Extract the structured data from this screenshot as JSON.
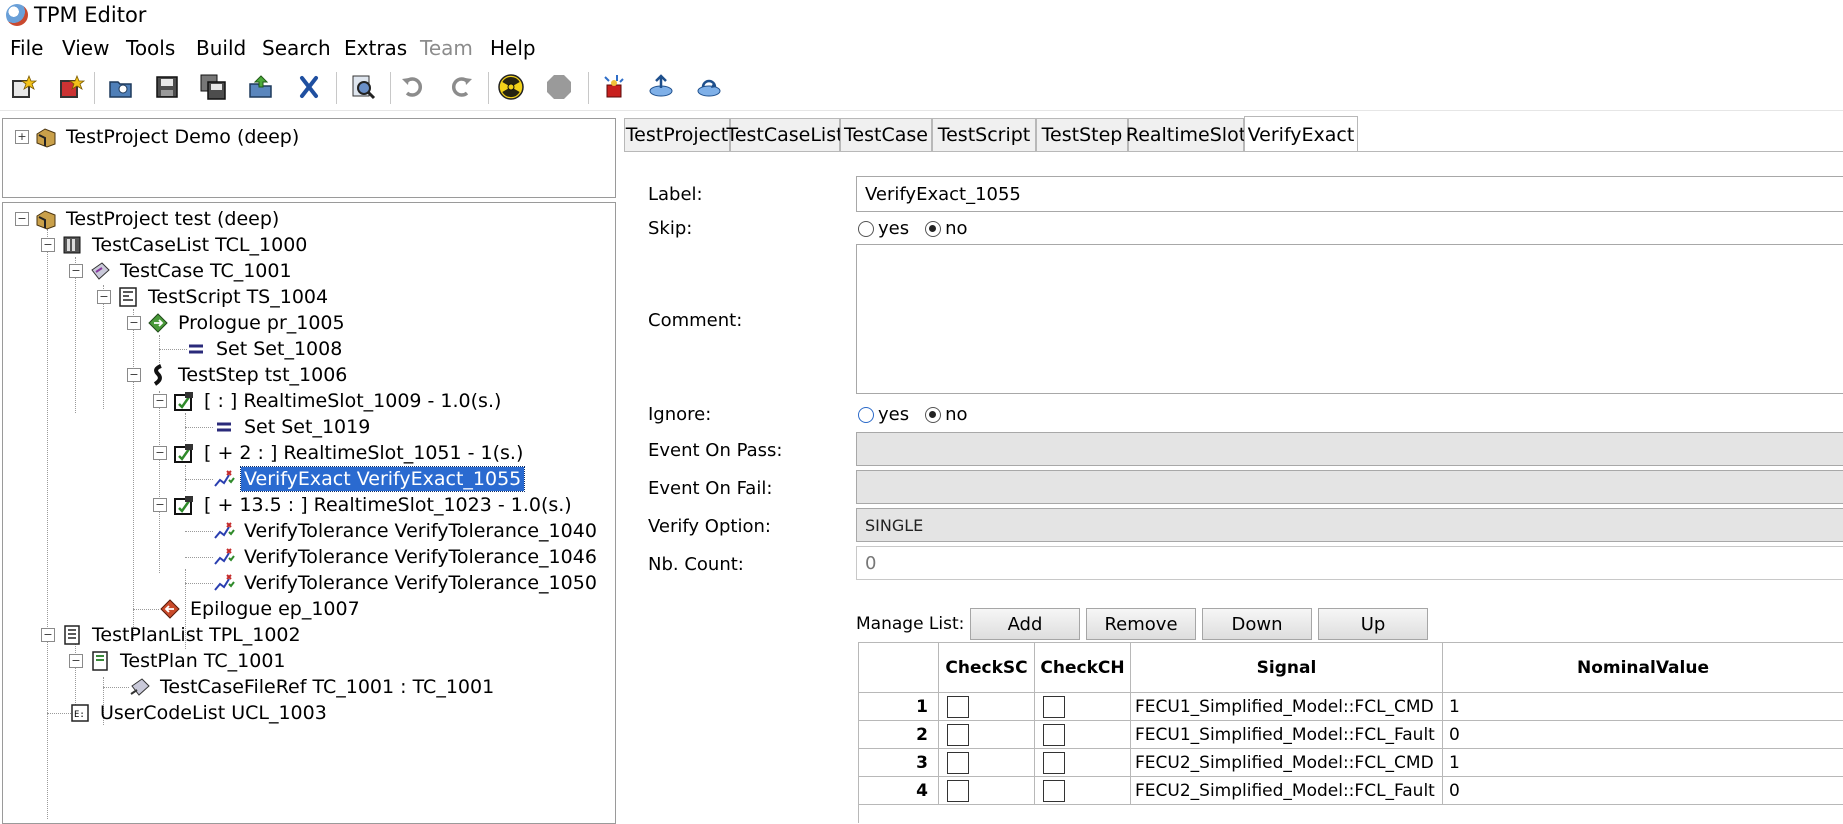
{
  "window": {
    "title": "TPM Editor",
    "app_icon": "tpm-globe-icon"
  },
  "menu": [
    "File",
    "View",
    "Tools",
    "Build",
    "Search",
    "Extras",
    "Team",
    "Help"
  ],
  "menu_disabled": [
    "Team"
  ],
  "toolbar": {
    "icons": [
      "new-project-icon",
      "new-file-icon",
      "open-icon",
      "save-icon",
      "save-all-icon",
      "export-icon",
      "delete-icon",
      "find-icon",
      "undo-icon",
      "redo-icon",
      "radiation-run-icon",
      "stop-icon",
      "deploy-icon",
      "connect-icon",
      "transfer-icon"
    ]
  },
  "tree_top": {
    "items": [
      {
        "label": "TestProject Demo (deep)",
        "icon": "project-icon",
        "expander": "+"
      }
    ]
  },
  "tree": {
    "items": [
      {
        "label": "TestProject test (deep)",
        "icon": "project-icon",
        "expander": "−"
      },
      {
        "label": "TestCaseList TCL_1000",
        "icon": "testcaselist-icon",
        "expander": "−"
      },
      {
        "label": "TestCase TC_1001",
        "icon": "testcase-icon",
        "expander": "−"
      },
      {
        "label": "TestScript TS_1004",
        "icon": "testscript-icon",
        "expander": "−"
      },
      {
        "label": "Prologue pr_1005",
        "icon": "prologue-icon",
        "expander": "−"
      },
      {
        "label": "Set Set_1008",
        "icon": "set-icon",
        "expander": ""
      },
      {
        "label": "TestStep tst_1006",
        "icon": "teststep-icon",
        "expander": "−"
      },
      {
        "label": "[ : ] RealtimeSlot_1009 - 1.0(s.)",
        "icon": "realtimeslot-icon",
        "expander": "−"
      },
      {
        "label": "Set Set_1019",
        "icon": "set-icon",
        "expander": ""
      },
      {
        "label": "[ + 2 : ] RealtimeSlot_1051 - 1(s.)",
        "icon": "realtimeslot-icon",
        "expander": "−"
      },
      {
        "label": "VerifyExact VerifyExact_1055",
        "icon": "verify-icon",
        "expander": "",
        "selected": true
      },
      {
        "label": "[ + 13.5 : ] RealtimeSlot_1023 - 1.0(s.)",
        "icon": "realtimeslot-icon",
        "expander": "−"
      },
      {
        "label": "VerifyTolerance VerifyTolerance_1040",
        "icon": "verify-icon",
        "expander": ""
      },
      {
        "label": "VerifyTolerance VerifyTolerance_1046",
        "icon": "verify-icon",
        "expander": ""
      },
      {
        "label": "VerifyTolerance VerifyTolerance_1050",
        "icon": "verify-icon",
        "expander": ""
      },
      {
        "label": "Epilogue ep_1007",
        "icon": "epilogue-icon",
        "expander": ""
      },
      {
        "label": "TestPlanList TPL_1002",
        "icon": "testplanlist-icon",
        "expander": "−"
      },
      {
        "label": "TestPlan TC_1001",
        "icon": "testplan-icon",
        "expander": "−"
      },
      {
        "label": "TestCaseFileRef TC_1001 : TC_1001",
        "icon": "testcasefileref-icon",
        "expander": ""
      },
      {
        "label": "UserCodeList UCL_1003",
        "icon": "usercodelist-icon",
        "expander": ""
      }
    ]
  },
  "tabs": [
    "TestProject",
    "TestCaseList",
    "TestCase",
    "TestScript",
    "TestStep",
    "RealtimeSlot",
    "VerifyExact"
  ],
  "active_tab": "VerifyExact",
  "form": {
    "label_label": "Label:",
    "label_value": "VerifyExact_1055",
    "skip_label": "Skip:",
    "comment_label": "Comment:",
    "comment_value": "",
    "ignore_label": "Ignore:",
    "yes": "yes",
    "no": "no",
    "skip_selected": "no",
    "ignore_selected": "no",
    "event_pass_label": "Event On Pass:",
    "event_pass_value": "",
    "event_fail_label": "Event On Fail:",
    "event_fail_value": "",
    "verify_option_label": "Verify Option:",
    "verify_option_value": "SINGLE",
    "nb_count_label": "Nb. Count:",
    "nb_count_value": "0"
  },
  "manage_list": {
    "label": "Manage List:",
    "buttons": [
      "Add",
      "Remove",
      "Down",
      "Up"
    ]
  },
  "grid": {
    "columns": [
      "",
      "CheckSC",
      "CheckCH",
      "Signal",
      "NominalValue"
    ],
    "rows": [
      {
        "num": "1",
        "checksc": false,
        "checkch": false,
        "signal": "FECU1_Simplified_Model::FCL_CMD",
        "nominal": "1"
      },
      {
        "num": "2",
        "checksc": false,
        "checkch": false,
        "signal": "FECU1_Simplified_Model::FCL_Fault",
        "nominal": "0"
      },
      {
        "num": "3",
        "checksc": false,
        "checkch": false,
        "signal": "FECU2_Simplified_Model::FCL_CMD",
        "nominal": "1"
      },
      {
        "num": "4",
        "checksc": false,
        "checkch": false,
        "signal": "FECU2_Simplified_Model::FCL_Fault",
        "nominal": "0"
      }
    ]
  }
}
